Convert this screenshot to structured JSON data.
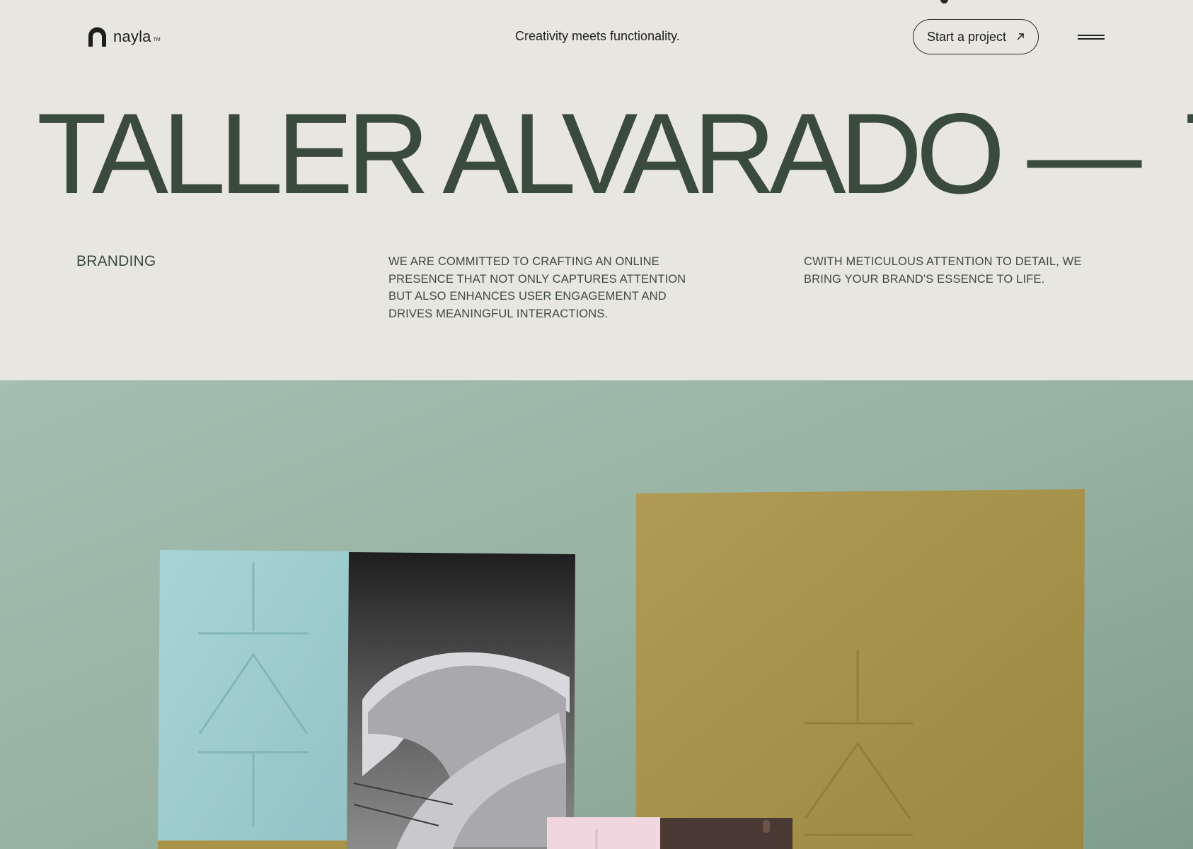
{
  "brand": {
    "name": "nayla",
    "tm": "TM",
    "logo_icon": "arch-logo-icon"
  },
  "header": {
    "tagline": "Creativity meets functionality.",
    "cta_label": "Start a project",
    "cta_icon": "arrow-up-right-icon",
    "menu_icon": "hamburger-menu-icon"
  },
  "project": {
    "title": "TALLER ALVARADO",
    "separator": "—",
    "title_repeat": "TALLER ALVARADO",
    "category": "BRANDING",
    "description_1": "We are committed to crafting an online presence that not only captures attention but also enhances user engagement and drives meaningful interactions.",
    "description_2": "Cwith meticulous attention to detail, we bring your brand's essence to life."
  },
  "colors": {
    "page_bg": "#e8e6e1",
    "title_green": "#3b4b3b",
    "image_bg": "#99b3a5",
    "card_blue": "#9fcfd2",
    "card_gold": "#a99449",
    "card_pink": "#f0d6df"
  }
}
